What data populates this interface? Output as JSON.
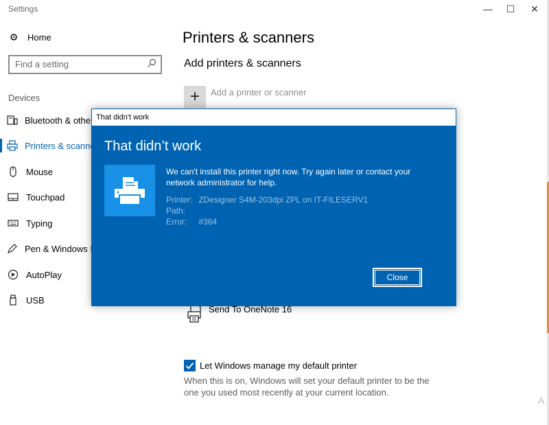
{
  "window": {
    "title": "Settings",
    "minimize": "—",
    "maximize": "☐",
    "close": "✕"
  },
  "sidebar": {
    "home_label": "Home",
    "search_placeholder": "Find a setting",
    "section_label": "Devices",
    "items": [
      {
        "label": "Bluetooth & other devices",
        "icon": "bluetooth-devices-icon"
      },
      {
        "label": "Printers & scanners",
        "icon": "printer-icon",
        "active": true
      },
      {
        "label": "Mouse",
        "icon": "mouse-icon"
      },
      {
        "label": "Touchpad",
        "icon": "touchpad-icon"
      },
      {
        "label": "Typing",
        "icon": "keyboard-icon"
      },
      {
        "label": "Pen & Windows Ink",
        "icon": "pen-icon"
      },
      {
        "label": "AutoPlay",
        "icon": "autoplay-icon"
      },
      {
        "label": "USB",
        "icon": "usb-icon"
      }
    ]
  },
  "main": {
    "title": "Printers & scanners",
    "add_section_title": "Add printers & scanners",
    "add_button": "+",
    "add_label": "Add a printer or scanner",
    "printer_item": "Send To OneNote 16",
    "default_checkbox_label": "Let Windows manage my default printer",
    "default_description": "When this is on, Windows will set your default printer to be the one you used most recently at your current location.",
    "cut_char": "A"
  },
  "dialog": {
    "bar_title": "That didn't work",
    "heading": "That didn’t work",
    "message": "We can't install this printer right now. Try again later or contact your network administrator for help.",
    "printer_key": "Printer:",
    "printer_value": "ZDesigner S4M-203dpi ZPL on IT-FILESERV1",
    "path_key": "Path:",
    "path_value": "",
    "error_key": "Error:",
    "error_value": "#384",
    "close_label": "Close"
  },
  "colors": {
    "accent": "#0063b1",
    "dialog_tile": "#1890e6",
    "secondary_text": "#9dc0e2"
  }
}
